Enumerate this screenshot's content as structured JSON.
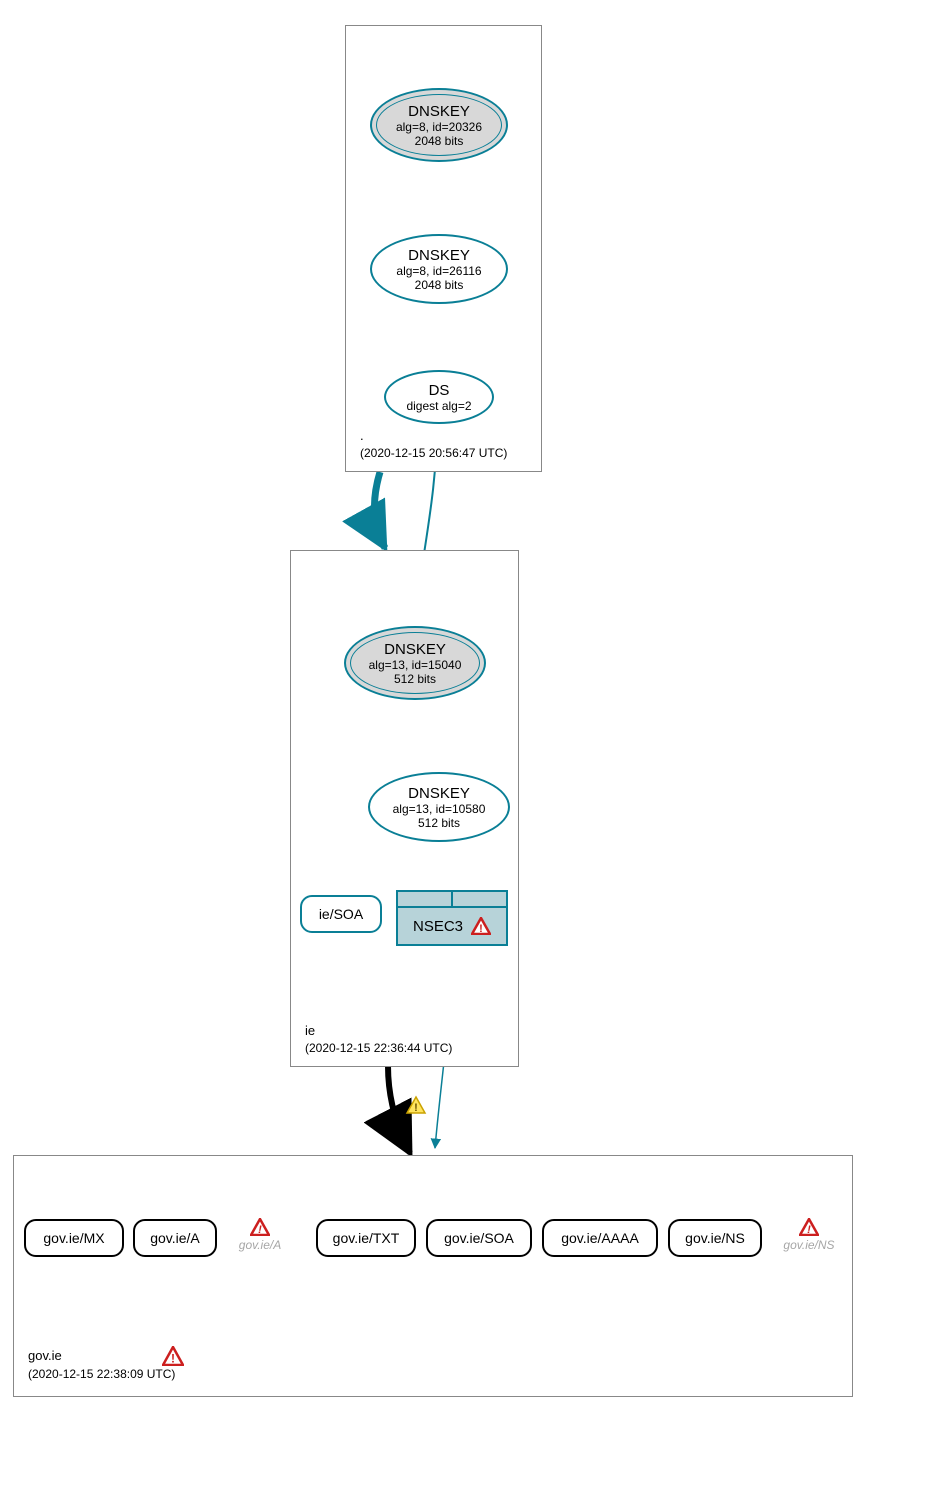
{
  "zones": {
    "root": {
      "name": ".",
      "timestamp": "(2020-12-15 20:56:47 UTC)"
    },
    "ie": {
      "name": "ie",
      "timestamp": "(2020-12-15 22:36:44 UTC)"
    },
    "gov": {
      "name": "gov.ie",
      "timestamp": "(2020-12-15 22:38:09 UTC)"
    }
  },
  "nodes": {
    "root_ksk": {
      "title": "DNSKEY",
      "sub1": "alg=8, id=20326",
      "sub2": "2048 bits"
    },
    "root_zsk": {
      "title": "DNSKEY",
      "sub1": "alg=8, id=26116",
      "sub2": "2048 bits"
    },
    "root_ds": {
      "title": "DS",
      "sub1": "digest alg=2"
    },
    "ie_ksk": {
      "title": "DNSKEY",
      "sub1": "alg=13, id=15040",
      "sub2": "512 bits"
    },
    "ie_zsk": {
      "title": "DNSKEY",
      "sub1": "alg=13, id=10580",
      "sub2": "512 bits"
    },
    "ie_soa": {
      "label": "ie/SOA"
    },
    "nsec3": {
      "label": "NSEC3"
    },
    "gov_mx": {
      "label": "gov.ie/MX"
    },
    "gov_a": {
      "label": "gov.ie/A"
    },
    "gov_a_err": {
      "label": "gov.ie/A"
    },
    "gov_txt": {
      "label": "gov.ie/TXT"
    },
    "gov_soa": {
      "label": "gov.ie/SOA"
    },
    "gov_aaaa": {
      "label": "gov.ie/AAAA"
    },
    "gov_ns": {
      "label": "gov.ie/NS"
    },
    "gov_ns_err": {
      "label": "gov.ie/NS"
    }
  },
  "icons": {
    "error_red": "error-icon",
    "warn_yellow": "warning-icon"
  }
}
